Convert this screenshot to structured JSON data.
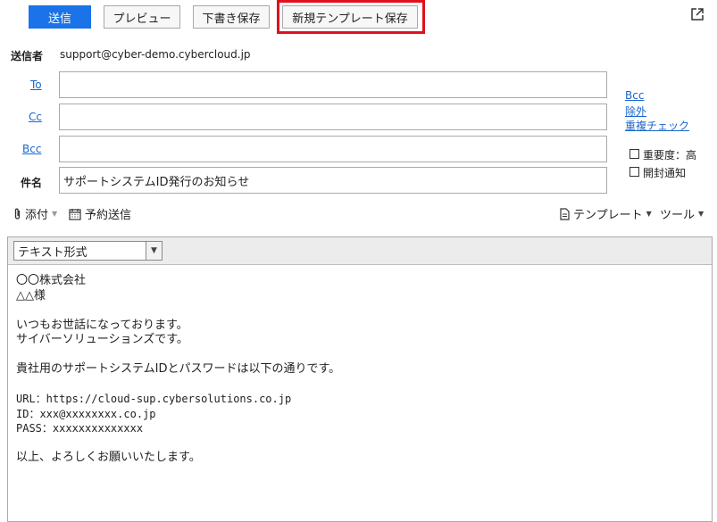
{
  "toolbar": {
    "send_label": "送信",
    "preview_label": "プレビュー",
    "draft_label": "下書き保存",
    "template_save_label": "新規テンプレート保存"
  },
  "sender": {
    "label": "送信者",
    "value": "support@cyber-demo.cybercloud.jp"
  },
  "to": {
    "label": "To",
    "value": ""
  },
  "cc": {
    "label": "Cc",
    "value": ""
  },
  "bcc": {
    "label": "Bcc",
    "value": ""
  },
  "subject": {
    "label": "件名",
    "value": "サポートシステムID発行のお知らせ"
  },
  "side_links": {
    "bcc": "Bcc",
    "exclude": "除外",
    "duplicate_check": "重複チェック"
  },
  "options": {
    "importance": "重要度：高",
    "read_receipt": "開封通知"
  },
  "actions": {
    "attach": "添付",
    "schedule": "予約送信",
    "template": "テンプレート",
    "tools": "ツール"
  },
  "editor": {
    "format": "テキスト形式",
    "lines": [
      "〇〇株式会社",
      "△△様",
      "",
      "いつもお世話になっております。",
      "サイバーソリューションズです。",
      "",
      "貴社用のサポートシステムIDとパスワードは以下の通りです。",
      "",
      "URL：https://cloud-sup.cybersolutions.co.jp",
      "ID：xxx@xxxxxxxx.co.jp",
      "PASS：xxxxxxxxxxxxxx",
      "",
      "以上、よろしくお願いいたします。"
    ]
  }
}
